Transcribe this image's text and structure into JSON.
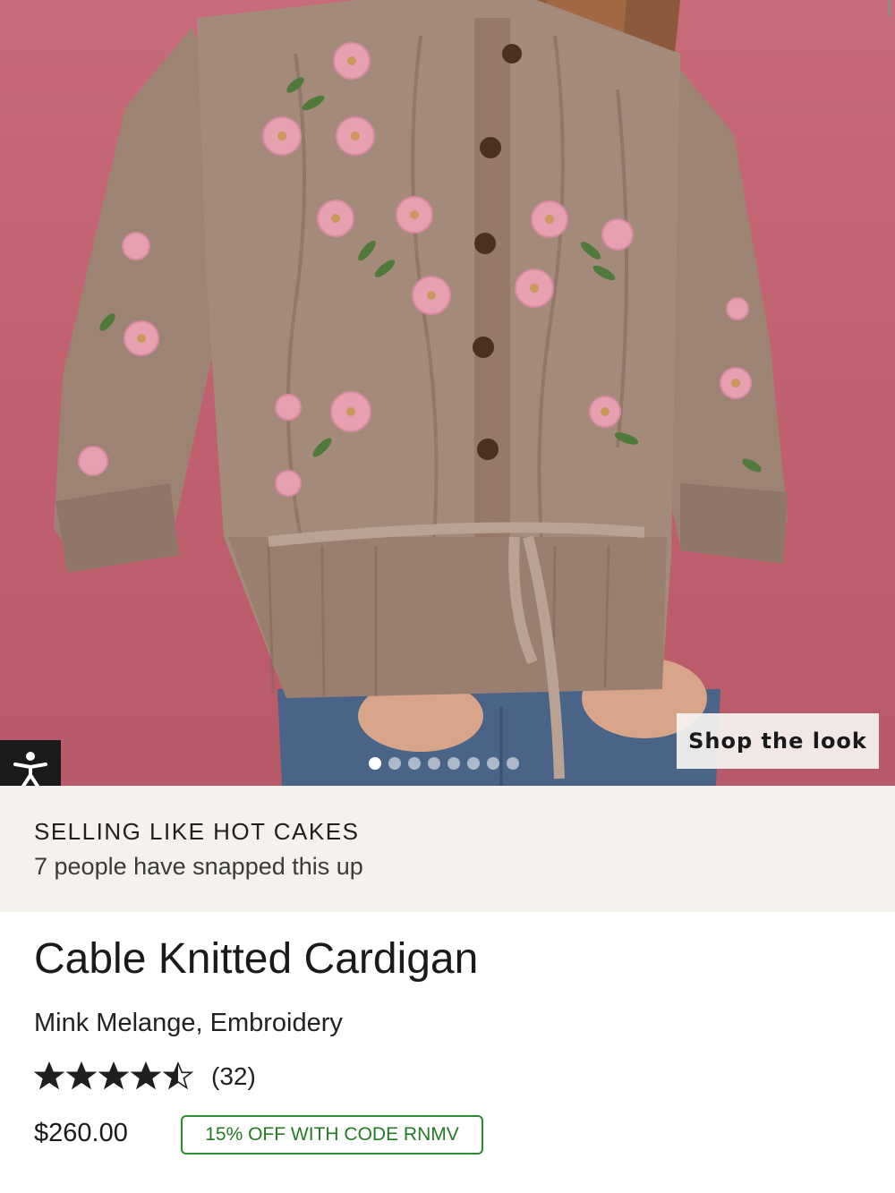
{
  "hero": {
    "image_subject": "Model wearing a cable knitted cardigan with floral embroidery",
    "shop_the_look_label": "Shop the look",
    "carousel": {
      "total_slides": 8,
      "active_index": 0
    },
    "background_color": "#c4646f"
  },
  "accessibility": {
    "icon": "accessibility-person-icon"
  },
  "banner": {
    "title": "SELLING LIKE HOT CAKES",
    "subtitle": "7 people have snapped this up"
  },
  "product": {
    "title": "Cable Knitted Cardigan",
    "variant": "Mink Melange, Embroidery",
    "rating": 4.5,
    "review_count": "(32)",
    "price": "$260.00",
    "promo": "15% OFF WITH CODE RNMV"
  },
  "colors": {
    "promo_green": "#2e8a2e",
    "banner_bg": "#f5f2ee",
    "text": "#1a1a1a"
  }
}
